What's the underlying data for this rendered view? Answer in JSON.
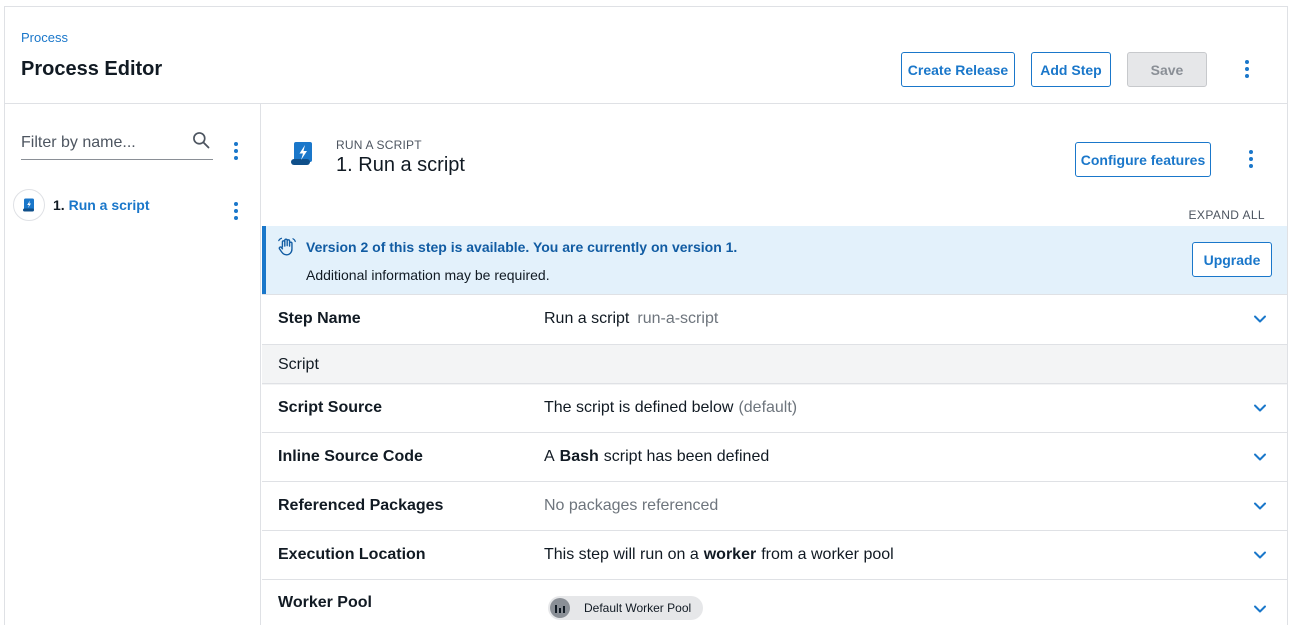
{
  "header": {
    "breadcrumb": "Process",
    "title": "Process Editor",
    "create_release_label": "Create Release",
    "add_step_label": "Add Step",
    "save_label": "Save"
  },
  "sidebar": {
    "filter_placeholder": "Filter by name...",
    "items": [
      {
        "number": "1.",
        "label": "Run a script"
      }
    ]
  },
  "step": {
    "kind": "RUN A SCRIPT",
    "number": "1.",
    "title": "Run a script",
    "configure_label": "Configure features",
    "expand_all_label": "EXPAND ALL"
  },
  "banner": {
    "message": "Version 2 of this step is available. You are currently on version 1.",
    "sub": "Additional information may be required.",
    "upgrade_label": "Upgrade"
  },
  "rows": {
    "step_name": {
      "label": "Step Name",
      "value": "Run a script",
      "slug": "run-a-script"
    },
    "section_script": "Script",
    "script_source": {
      "label": "Script Source",
      "value": "The script is defined below",
      "hint": "(default)"
    },
    "inline_source": {
      "label": "Inline Source Code",
      "prefix": "A",
      "lang": "Bash",
      "suffix": "script has been defined"
    },
    "packages": {
      "label": "Referenced Packages",
      "value": "No packages referenced"
    },
    "execution": {
      "label": "Execution Location",
      "prefix": "This step will run on a",
      "strong": "worker",
      "suffix": "from a worker pool"
    },
    "worker_pool": {
      "label": "Worker Pool",
      "chip": "Default Worker Pool"
    }
  },
  "colors": {
    "accent": "#1a77ca",
    "banner_bg": "#e3f1fb",
    "text": "#111a23"
  }
}
